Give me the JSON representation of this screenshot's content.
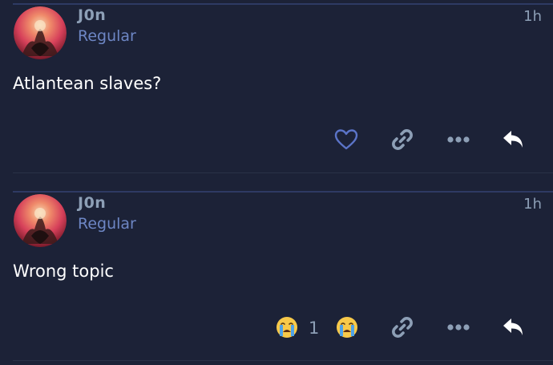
{
  "posts": [
    {
      "username": "J0n",
      "user_title": "Regular",
      "time": "1h",
      "body": "Atlantean slaves?",
      "actions": [
        "like",
        "copy-link",
        "more",
        "reply"
      ]
    },
    {
      "username": "J0n",
      "user_title": "Regular",
      "time": "1h",
      "body": "Wrong topic",
      "reaction": {
        "emoji": "😭",
        "count": "1"
      },
      "actions": [
        "reaction",
        "copy-link",
        "more",
        "reply"
      ]
    }
  ],
  "colors": {
    "background": "#1c2237",
    "username": "#8d9fb6",
    "user_title": "#6d86c4",
    "like_icon": "#5b74c8",
    "icon_gray": "#8d9fb6",
    "reply_icon": "#ffffff"
  }
}
